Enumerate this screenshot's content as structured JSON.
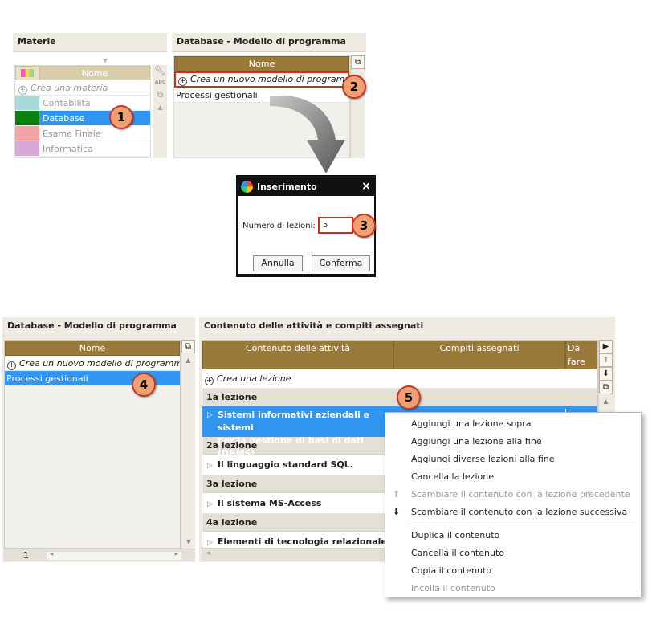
{
  "top_left": {
    "title": "Materie",
    "col_name": "Nome",
    "create_label": "Crea una materia",
    "items": [
      {
        "label": "Contabilità",
        "color": "#a8d8d8"
      },
      {
        "label": "Database",
        "color": "#0f7f0f"
      },
      {
        "label": "Esame Finale",
        "color": "#f4a4a4"
      },
      {
        "label": "Informatica",
        "color": "#d8a8d8"
      }
    ],
    "abc": "ABC"
  },
  "top_right": {
    "title": "Database - Modello di programma",
    "col_name": "Nome",
    "create_label": "Crea un nuovo modello di programma",
    "input_value": "Processi gestionali"
  },
  "dialog": {
    "title": "Inserimento",
    "close": "×",
    "field_label": "Numero di lezioni:",
    "field_value": "5",
    "cancel": "Annulla",
    "confirm": "Conferma"
  },
  "badges": [
    "1",
    "2",
    "3",
    "4",
    "5"
  ],
  "bottom_left": {
    "title": "Database - Modello di programma",
    "col_name": "Nome",
    "create_label": "Crea un nuovo modello di programma",
    "selected_item": "Processi gestionali",
    "page_number": "1"
  },
  "bottom_right": {
    "title": "Contenuto delle attività e compiti assegnati",
    "col_content": "Contenuto delle attività",
    "col_tasks": "Compiti assegnati",
    "col_todo": "Da fare",
    "create_label": "Crea una lezione",
    "lessons": [
      {
        "head": "1a lezione",
        "line1": "Sistemi informativi aziendali e sistemi",
        "line2": "per la gestione di basi di dati (DBMS)."
      },
      {
        "head": "2a lezione",
        "line1": "Il linguaggio standard SQL."
      },
      {
        "head": "3a lezione",
        "line1": "Il sistema MS-Access"
      },
      {
        "head": "4a lezione",
        "line1": "Elementi di tecnologia relazionale"
      }
    ]
  },
  "context_menu": {
    "items": [
      {
        "label": "Aggiungi una lezione sopra",
        "disabled": false
      },
      {
        "label": "Aggiungi una lezione alla fine",
        "disabled": false
      },
      {
        "label": "Aggiungi diverse lezioni alla fine",
        "disabled": false
      },
      {
        "label": "Cancella la lezione",
        "disabled": false
      },
      {
        "label": "Scambiare il contenuto con la lezione precedente",
        "disabled": true
      },
      {
        "label": "Scambiare il contenuto con la lezione successiva",
        "disabled": false
      },
      {
        "label": "Duplica il contenuto",
        "disabled": false
      },
      {
        "label": "Cancella il contenuto",
        "disabled": false
      },
      {
        "label": "Copia il contenuto",
        "disabled": false
      },
      {
        "label": "Incolla il contenuto",
        "disabled": true
      }
    ]
  }
}
